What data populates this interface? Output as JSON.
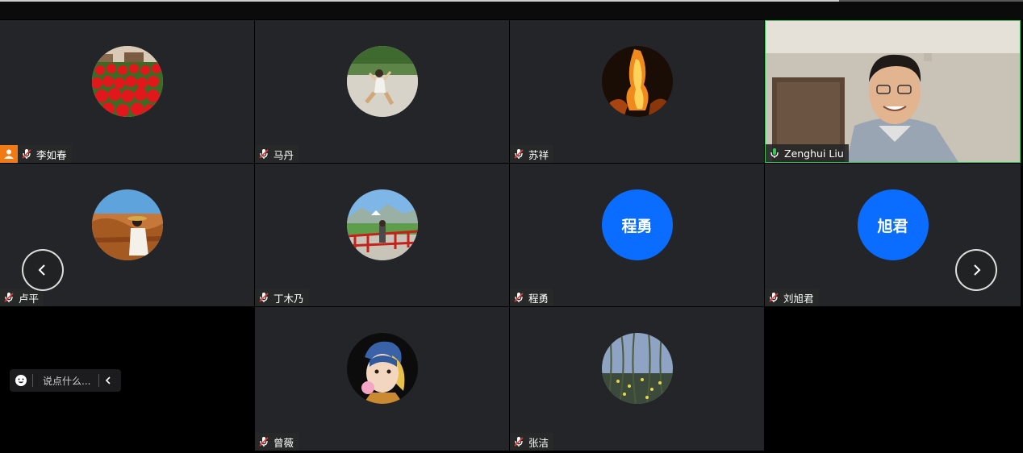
{
  "participants": [
    {
      "name": "李如春",
      "host": true
    },
    {
      "name": "马丹"
    },
    {
      "name": "苏祥"
    },
    {
      "name": "Zenghui Liu",
      "mic": "active"
    },
    {
      "name": "卢平"
    },
    {
      "name": "丁木乃"
    },
    {
      "name": "程勇",
      "avatar_text": "程勇"
    },
    {
      "name": "刘旭君",
      "avatar_text": "旭君"
    },
    {
      "name": "曾薇"
    },
    {
      "name": "张洁"
    }
  ],
  "chat": {
    "placeholder": "说点什么..."
  },
  "colors": {
    "tile_bg": "#232528",
    "avatar_blue": "#0b6dff",
    "host_orange": "#f27a14",
    "mic_active": "#35c759",
    "mic_muted": "#ffffff"
  }
}
